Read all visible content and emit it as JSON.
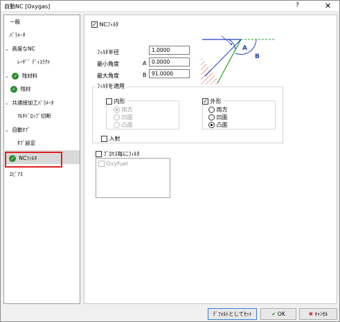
{
  "window": {
    "title": "自動NC [Oxygas]",
    "help_label": "?",
    "close_label": "✕"
  },
  "sidebar": {
    "items": [
      {
        "label": "一般"
      },
      {
        "label": "ﾊﾟﾗﾒｰﾀ"
      },
      {
        "label": "高度なNC",
        "chevron": "⌄"
      },
      {
        "label": "ﾚｰｻﾞﾞ ﾃﾞｨｽﾗｸﾄ"
      },
      {
        "label": "残材料",
        "chevron": "⌄"
      },
      {
        "label": "残材"
      },
      {
        "label": "共通接加工ﾊﾟﾗﾒｰﾀ",
        "chevron": "⌄"
      },
      {
        "label": "ﾏﾙﾁﾄﾞﾛｯﾌﾟ切断"
      },
      {
        "label": "自動ﾀﾌﾞ",
        "chevron": "⌄"
      },
      {
        "label": "ﾀﾌﾞ設定"
      },
      {
        "label": "NCﾌｨﾙﾀ"
      },
      {
        "label": "ｴﾋﾞｱｽ"
      }
    ]
  },
  "nc_filter": {
    "enable_label": "NCﾌｨﾙﾀ",
    "enable_checked": true,
    "radius_label": "ﾌｨﾙﾀ半径",
    "radius_value": "1.0000",
    "min_angle_label": "最小角度",
    "min_angle_letter": "A",
    "min_angle_value": "0.0000",
    "max_angle_label": "最大角度",
    "max_angle_letter": "B",
    "max_angle_value": "91.0000",
    "diagram_label_a": "A",
    "diagram_label_b": "B"
  },
  "apply_filter": {
    "group_label": "ﾌｨﾙﾀを適用",
    "inner": {
      "label": "内形",
      "checked": false,
      "options": [
        "両方",
        "凹面",
        "凸面"
      ],
      "selected": "両方"
    },
    "outer": {
      "label": "外形",
      "checked": true,
      "options": [
        "両方",
        "凹面",
        "凸面"
      ],
      "selected": "凸面"
    },
    "lead_in_label": "入射"
  },
  "process_filter": {
    "label": "ﾌﾟﾛｾｽ毎にﾌｨﾙﾀ",
    "list_items": [
      "Oxyfuel"
    ]
  },
  "buttons": {
    "set_default": "ﾃﾞﾌｫﾙﾄとしてｾｯﾄ",
    "ok": "OK",
    "cancel": "ｷｬﾝｾﾙ"
  },
  "colors": {
    "selection_highlight": "#d9d9d9",
    "annotation_red": "#e02020",
    "diagram_blue": "#1f3fbf",
    "diagram_green": "#1fa01f",
    "diagram_hatch": "#e05050",
    "check_green": "#2e8b2e"
  }
}
